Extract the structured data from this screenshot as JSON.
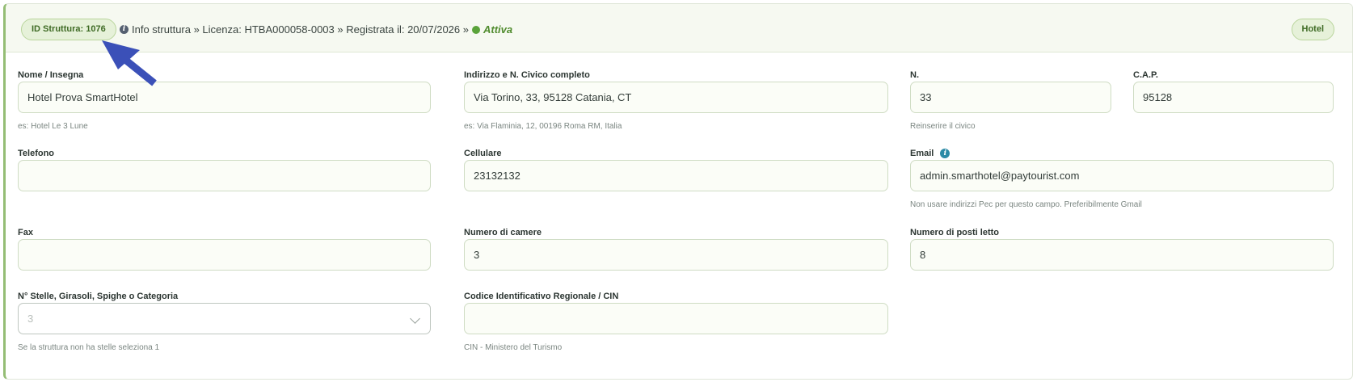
{
  "header": {
    "id_badge": "ID Struttura: 1076",
    "info_text": "Info struttura » Licenza: HTBA000058-0003 » Registrata il: 20/07/2026 »",
    "status": "Attiva",
    "type_badge": "Hotel"
  },
  "icons": {
    "info": "info-circle-icon",
    "status": "status-dot-icon",
    "select": "chevron-down-icon",
    "annotation": "arrow-icon"
  },
  "colors": {
    "accent": "#94bd74",
    "status_active": "#5aa33a",
    "arrow": "#3b50b8"
  },
  "fields": {
    "nome": {
      "label": "Nome / Insegna",
      "value": "Hotel Prova SmartHotel",
      "help": "es: Hotel Le 3 Lune"
    },
    "indirizzo": {
      "label": "Indirizzo e N. Civico completo",
      "value": "Via Torino, 33, 95128 Catania, CT",
      "help": "es: Via Flaminia, 12, 00196 Roma RM, Italia"
    },
    "numero": {
      "label": "N.",
      "value": "33",
      "help": "Reinserire il civico"
    },
    "cap": {
      "label": "C.A.P.",
      "value": "95128"
    },
    "telefono": {
      "label": "Telefono",
      "value": ""
    },
    "cellulare": {
      "label": "Cellulare",
      "value": "23132132"
    },
    "email": {
      "label": "Email",
      "value": "admin.smarthotel@paytourist.com",
      "help": "Non usare indirizzi Pec per questo campo. Preferibilmente Gmail"
    },
    "fax": {
      "label": "Fax",
      "value": ""
    },
    "camere": {
      "label": "Numero di camere",
      "value": "3"
    },
    "posti_letto": {
      "label": "Numero di posti letto",
      "value": "8"
    },
    "stelle": {
      "label": "N° Stelle, Girasoli, Spighe o Categoria",
      "value": "3",
      "help": "Se la struttura non ha stelle seleziona 1"
    },
    "cin": {
      "label": "Codice Identificativo Regionale / CIN",
      "value": "",
      "help": "CIN - Ministero del Turismo"
    }
  }
}
